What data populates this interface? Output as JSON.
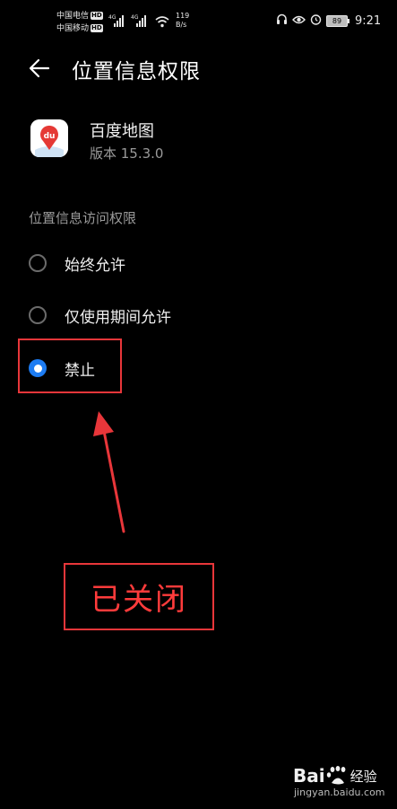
{
  "status_bar": {
    "carrier1": "中国电信",
    "carrier2": "中国移动",
    "hd_badge": "HD",
    "net1": "4G",
    "net2": "4G",
    "speed_value": "119",
    "speed_unit": "B/s",
    "battery": "89",
    "time": "9:21",
    "icons": [
      "signal-icon",
      "wifi-icon",
      "headset-icon",
      "eye-icon",
      "alarm-icon",
      "battery-icon"
    ]
  },
  "header": {
    "back_icon": "back-arrow-icon",
    "title": "位置信息权限"
  },
  "app": {
    "icon": "baidu-map-app-icon",
    "icon_text": "du",
    "name": "百度地图",
    "version": "版本 15.3.0"
  },
  "section": {
    "label": "位置信息访问权限"
  },
  "options": [
    {
      "label": "始终允许",
      "selected": false
    },
    {
      "label": "仅使用期间允许",
      "selected": false
    },
    {
      "label": "禁止",
      "selected": true
    }
  ],
  "annotation": {
    "text": "已关闭",
    "color": "#e8363a"
  },
  "watermark": {
    "logo": "Bai",
    "logo_suffix": "经验",
    "url": "jingyan.baidu.com"
  }
}
